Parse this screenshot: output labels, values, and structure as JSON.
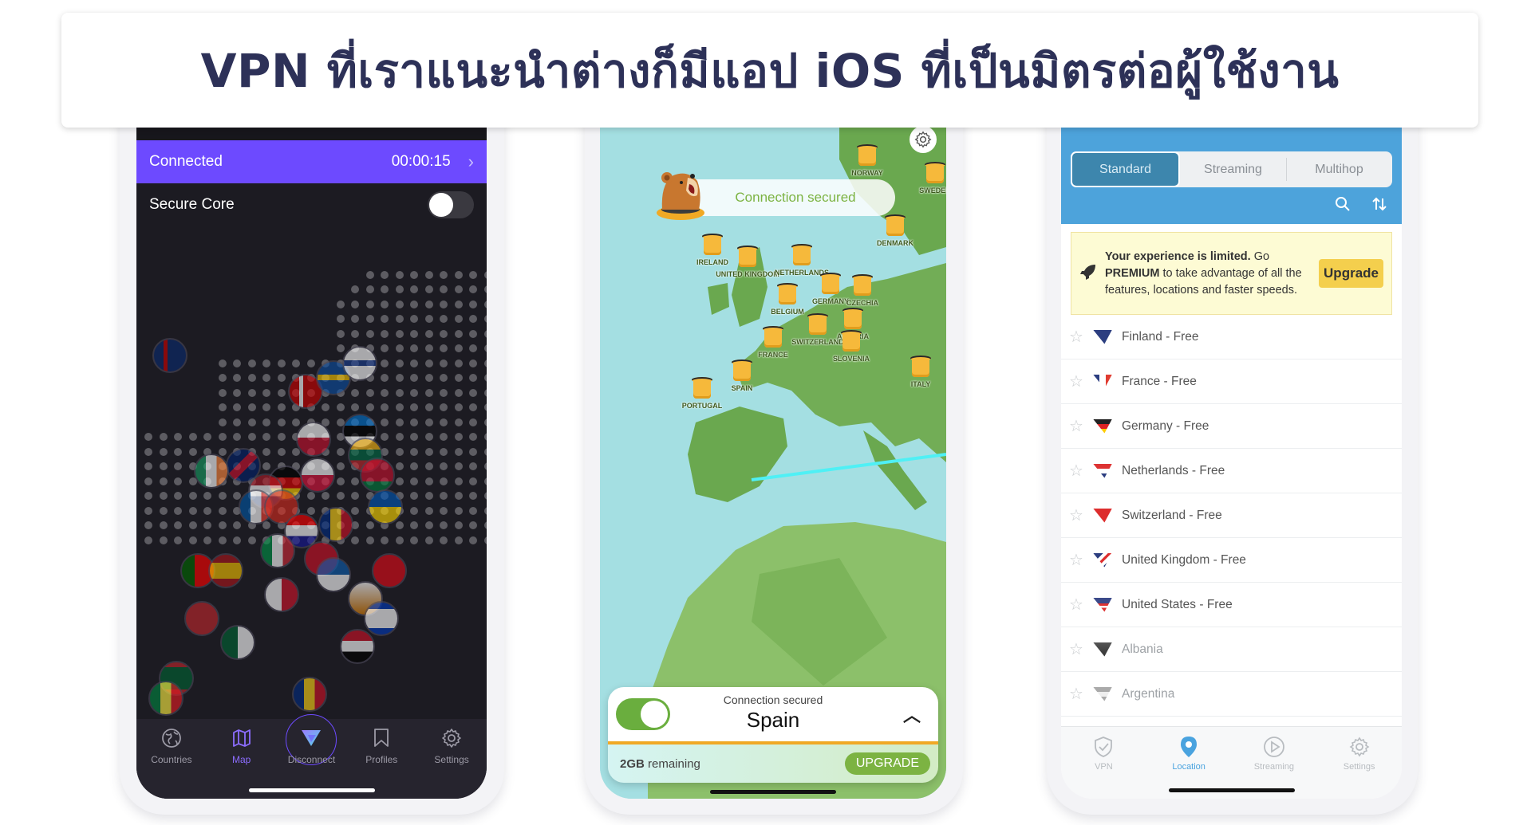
{
  "title": "VPN ที่เราแนะนำต่างก็มีแอป iOS ที่เป็นมิตรต่อผู้ใช้งาน",
  "phone_proton": {
    "status_label": "Connected",
    "timer": "00:00:15",
    "secure_core_label": "Secure Core",
    "secure_core_enabled": false,
    "accent_color": "#6d4aff",
    "nav": [
      {
        "label": "Countries",
        "icon": "globe-icon",
        "active": false
      },
      {
        "label": "Map",
        "icon": "map-icon",
        "active": true
      },
      {
        "label": "Disconnect",
        "icon": "proton-logo-icon",
        "active": false
      },
      {
        "label": "Profiles",
        "icon": "bookmark-icon",
        "active": false
      },
      {
        "label": "Settings",
        "icon": "gear-icon",
        "active": false
      }
    ]
  },
  "phone_tunnelbear": {
    "banner": "Connection secured",
    "countries": [
      "NORWAY",
      "SWEDEN",
      "DENMARK",
      "IRELAND",
      "UNITED KINGDOM",
      "NETHERLANDS",
      "GERMANY",
      "CZECHIA",
      "BELGIUM",
      "AUSTRIA",
      "SWITZERLAND",
      "FRANCE",
      "SLOVENIA",
      "SPAIN",
      "PORTUGAL",
      "ITALY"
    ],
    "card": {
      "status": "Connection secured",
      "country": "Spain",
      "remaining_amount": "2GB",
      "remaining_label": " remaining",
      "upgrade_label": "UPGRADE",
      "connected": true
    }
  },
  "phone_hotspot": {
    "tabs": [
      {
        "label": "Standard",
        "active": true
      },
      {
        "label": "Streaming",
        "active": false
      },
      {
        "label": "Multihop",
        "active": false
      }
    ],
    "banner": {
      "bold1": "Your experience is limited.",
      "text1": " Go ",
      "bold2": "PREMIUM",
      "text2": " to take advantage of all the features, locations and faster speeds.",
      "button": "Upgrade"
    },
    "locations": [
      {
        "name": "Finland - Free",
        "free": true
      },
      {
        "name": "France - Free",
        "free": true
      },
      {
        "name": "Germany - Free",
        "free": true
      },
      {
        "name": "Netherlands - Free",
        "free": true
      },
      {
        "name": "Switzerland - Free",
        "free": true
      },
      {
        "name": "United Kingdom - Free",
        "free": true
      },
      {
        "name": "United States - Free",
        "free": true
      },
      {
        "name": "Albania",
        "free": false
      },
      {
        "name": "Argentina",
        "free": false
      }
    ],
    "nav": [
      {
        "label": "VPN",
        "icon": "shield-check-icon",
        "active": false
      },
      {
        "label": "Location",
        "icon": "location-pin-icon",
        "active": true
      },
      {
        "label": "Streaming",
        "icon": "play-icon",
        "active": false
      },
      {
        "label": "Settings",
        "icon": "gear-icon",
        "active": false
      }
    ]
  }
}
